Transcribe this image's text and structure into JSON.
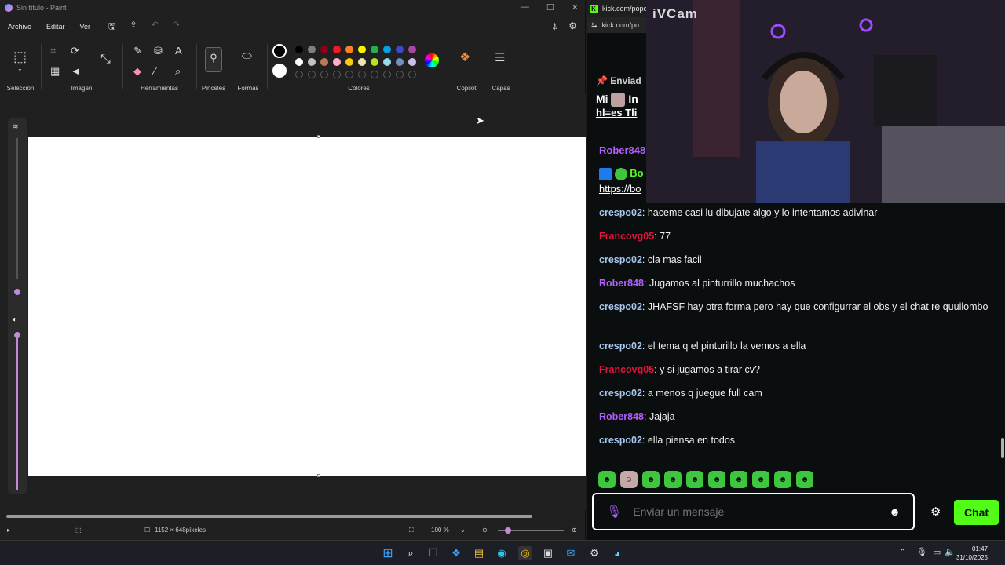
{
  "paint": {
    "title": "Sin título - Paint",
    "menu": {
      "file": "Archivo",
      "edit": "Editar",
      "view": "Ver"
    },
    "groups": {
      "selection": "Selección",
      "image": "Imagen",
      "tools": "Herramientas",
      "brushes": "Pinceles",
      "shapes": "Formas",
      "colors": "Colores",
      "copilot": "Copilot",
      "layers": "Capas"
    },
    "palette_row1": [
      "#000000",
      "#7f7f7f",
      "#880015",
      "#ed1c24",
      "#ff7f27",
      "#fff200",
      "#22b14c",
      "#00a2e8",
      "#3f48cc",
      "#a349a4"
    ],
    "palette_row2": [
      "#ffffff",
      "#c3c3c3",
      "#b97a57",
      "#ffaec9",
      "#ffc90e",
      "#efe4b0",
      "#b5e61d",
      "#99d9ea",
      "#7092be",
      "#c8bfe7"
    ],
    "primary_color": "#000000",
    "secondary_color": "#ffffff",
    "status": {
      "canvas_size": "1152 × 648píxeles",
      "zoom": "100 %"
    }
  },
  "browser": {
    "tab_title": "kick.com/popout",
    "url": "kick.com/po",
    "cam_label": "iVCam",
    "pinned": {
      "header": "Enviad",
      "line1": "Mi",
      "line1_tail": "In",
      "line2": "hl=es",
      "line2_tail": "Tli"
    },
    "partial_messages": [
      {
        "user": "Rober848",
        "text": ""
      },
      {
        "user": "Bo",
        "text": ""
      },
      {
        "user": "",
        "text": "https://bo"
      }
    ],
    "messages": [
      {
        "user": "crespo02",
        "text": "haceme casi lu dibujate algo y lo intentamos adivinar",
        "color": "#a8c7f0"
      },
      {
        "user": "Francovg05",
        "text": "77",
        "color": "#e0153a"
      },
      {
        "user": "crespo02",
        "text": "cla mas facil",
        "color": "#a8c7f0"
      },
      {
        "user": "Rober848",
        "text": "Jugamos al pinturrillo muchachos",
        "color": "#b45dff"
      },
      {
        "user": "crespo02",
        "text": "JHAFSF hay otra forma pero hay que configurrar el obs y el chat re quuilombo",
        "color": "#a8c7f0"
      },
      {
        "user": "crespo02",
        "text": "el tema q el pinturillo la vemos a ella",
        "color": "#a8c7f0"
      },
      {
        "user": "Francovg05",
        "text": "y si jugamos a tirar cv?",
        "color": "#e0153a"
      },
      {
        "user": "crespo02",
        "text": "a menos q juegue full cam",
        "color": "#a8c7f0"
      },
      {
        "user": "Rober848",
        "text": "Jajaja",
        "color": "#b45dff"
      },
      {
        "user": "crespo02",
        "text": "ella piensa en todos",
        "color": "#a8c7f0"
      }
    ],
    "input_placeholder": "Enviar un mensaje",
    "chat_button": "Chat"
  },
  "taskbar": {
    "time": "01:47",
    "date": "31/10/2025"
  }
}
